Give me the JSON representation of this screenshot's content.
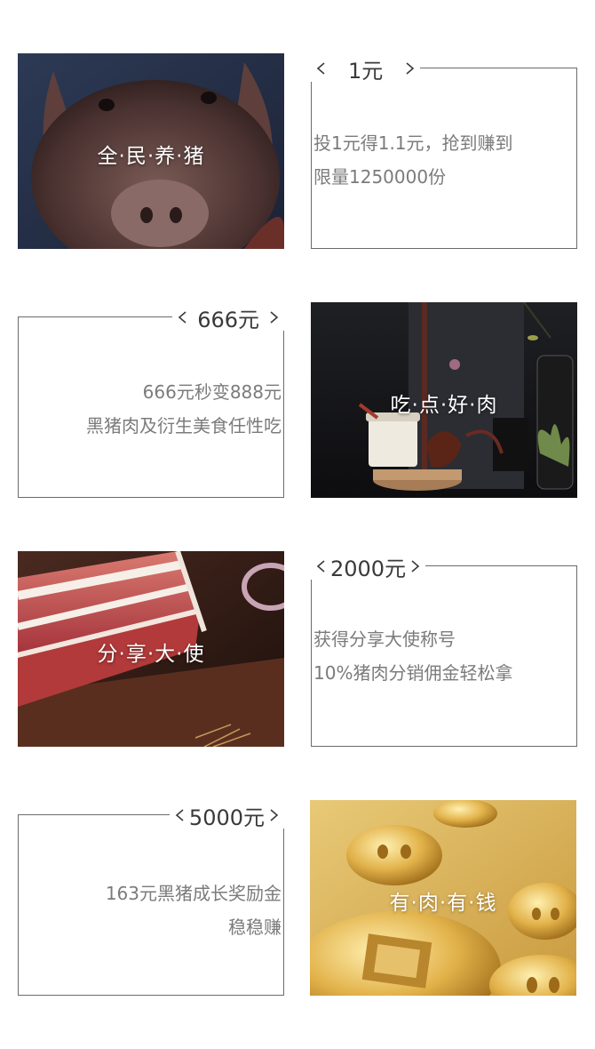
{
  "sections": [
    {
      "tile": {
        "title": "全·民·养·猪",
        "image": "piglet-photo"
      },
      "card": {
        "price": "1元",
        "lines": [
          "投1元得1.1元，抢到赚到",
          "限量1250000份"
        ]
      }
    },
    {
      "tile": {
        "title": "吃·点·好·肉",
        "image": "gift-box-photo"
      },
      "card": {
        "price": "666元",
        "lines": [
          "666元秒变888元",
          "黑猪肉及衍生美食任性吃"
        ]
      }
    },
    {
      "tile": {
        "title": "分·享·大·使",
        "image": "pork-belly-photo"
      },
      "card": {
        "price": "2000元",
        "lines": [
          "获得分享大使称号",
          "10%猪肉分销佣金轻松拿"
        ]
      }
    },
    {
      "tile": {
        "title": "有·肉·有·钱",
        "image": "gold-coins-photo"
      },
      "card": {
        "price": "5000元",
        "lines": [
          "163元黑猪成长奖励金",
          "稳稳赚"
        ]
      }
    }
  ],
  "colors": {
    "frame": "#6b6b6b",
    "price_text": "#3a3a3a",
    "desc_text": "#7b7b7b",
    "gold": "#d9b15a"
  },
  "icons": [
    "chevron-left-icon",
    "chevron-right-icon"
  ]
}
